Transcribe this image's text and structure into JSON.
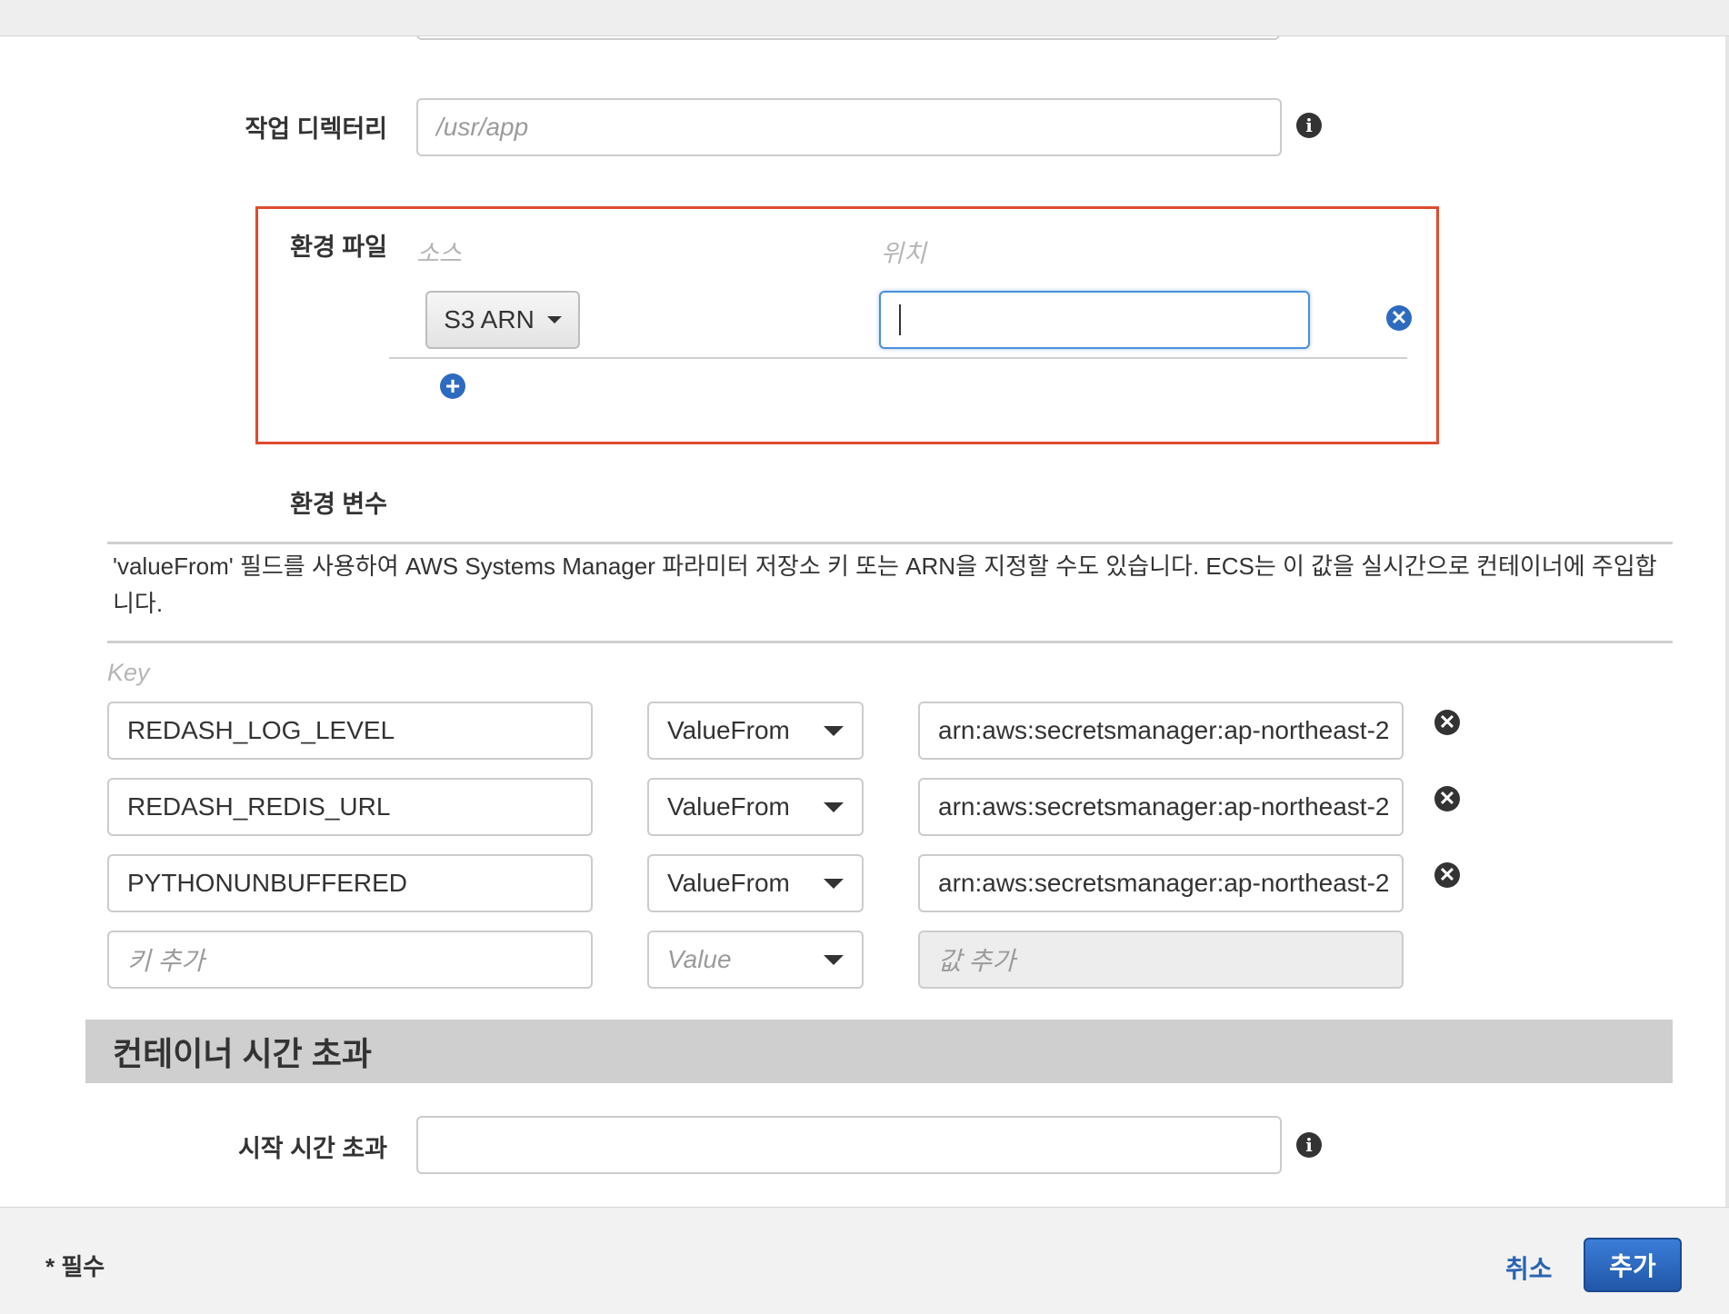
{
  "fields": {
    "working_dir": {
      "label": "작업 디렉터리",
      "placeholder": "/usr/app",
      "value": ""
    },
    "env_files": {
      "label": "환경 파일",
      "col_source": "소스",
      "col_location": "위치",
      "rows": [
        {
          "source": "S3 ARN",
          "location": ""
        }
      ]
    },
    "env_vars": {
      "label": "환경 변수",
      "note": "'valueFrom' 필드를 사용하여 AWS Systems Manager 파라미터 저장소 키 또는 ARN을 지정할 수도 있습니다. ECS는 이 값을 실시간으로 컨테이너에 주입합니다.",
      "key_header": "Key",
      "rows": [
        {
          "key": "REDASH_LOG_LEVEL",
          "type": "ValueFrom",
          "value": "arn:aws:secretsmanager:ap-northeast-2"
        },
        {
          "key": "REDASH_REDIS_URL",
          "type": "ValueFrom",
          "value": "arn:aws:secretsmanager:ap-northeast-2"
        },
        {
          "key": "PYTHONUNBUFFERED",
          "type": "ValueFrom",
          "value": "arn:aws:secretsmanager:ap-northeast-2"
        }
      ],
      "new_row": {
        "key_placeholder": "키 추가",
        "type": "Value",
        "value_placeholder": "값 추가"
      }
    }
  },
  "section_timeout": {
    "title": "컨테이너 시간 초과",
    "start_timeout": {
      "label": "시작 시간 초과",
      "value": ""
    }
  },
  "footer": {
    "required_note": "* 필수",
    "cancel_label": "취소",
    "submit_label": "추가"
  },
  "icons": {
    "info": "info-icon",
    "remove": "remove-circle-icon",
    "add": "add-circle-icon",
    "caret": "caret-down-icon"
  },
  "colors": {
    "highlight": "#e04b2f",
    "primary": "#2d6bc0",
    "section_bg": "#cfcfcf"
  }
}
